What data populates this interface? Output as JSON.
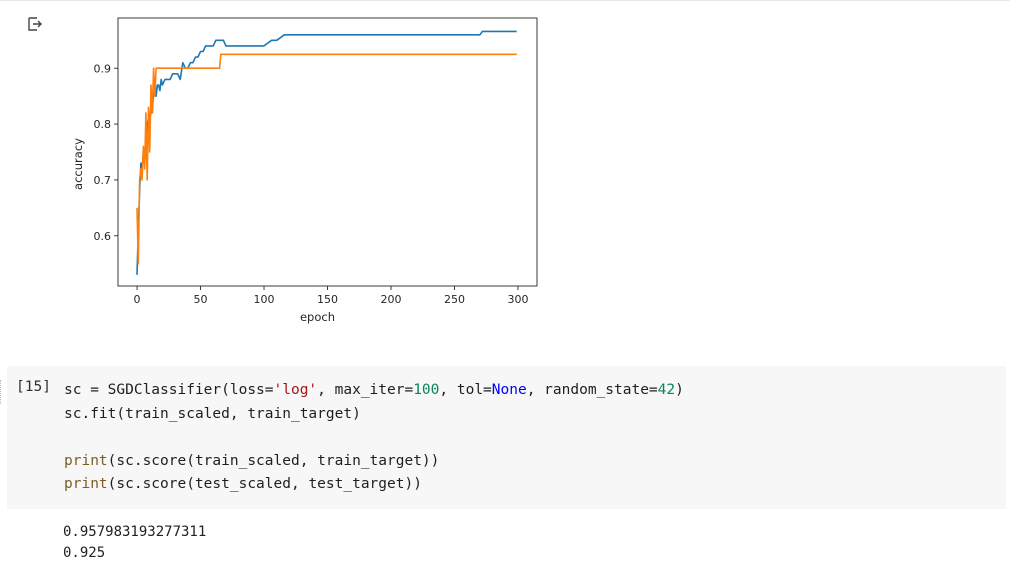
{
  "output_icon": "output-arrow-icon",
  "chart_data": {
    "type": "line",
    "xlabel": "epoch",
    "ylabel": "accuracy",
    "xlim": [
      -15,
      315
    ],
    "ylim": [
      0.51,
      0.99
    ],
    "xticks": [
      0,
      50,
      100,
      150,
      200,
      250,
      300
    ],
    "yticks": [
      0.6,
      0.7,
      0.8,
      0.9
    ],
    "ytick_labels": [
      "0.6",
      "0.7",
      "0.8",
      "0.9"
    ],
    "grid": false,
    "series": [
      {
        "color": "#1f77b4",
        "x": [
          0,
          1,
          2,
          3,
          4,
          5,
          6,
          7,
          8,
          9,
          10,
          11,
          12,
          13,
          14,
          15,
          16,
          17,
          18,
          19,
          20,
          22,
          24,
          26,
          28,
          30,
          32,
          34,
          36,
          38,
          40,
          42,
          44,
          46,
          48,
          50,
          52,
          54,
          56,
          58,
          60,
          62,
          64,
          66,
          68,
          70,
          80,
          90,
          100,
          106,
          110,
          116,
          120,
          140,
          160,
          200,
          240,
          270,
          272,
          299
        ],
        "y": [
          0.53,
          0.61,
          0.68,
          0.73,
          0.72,
          0.75,
          0.73,
          0.77,
          0.8,
          0.81,
          0.8,
          0.83,
          0.82,
          0.86,
          0.88,
          0.85,
          0.87,
          0.87,
          0.86,
          0.88,
          0.87,
          0.88,
          0.88,
          0.88,
          0.89,
          0.89,
          0.89,
          0.88,
          0.91,
          0.9,
          0.9,
          0.91,
          0.91,
          0.92,
          0.92,
          0.93,
          0.93,
          0.94,
          0.94,
          0.94,
          0.94,
          0.95,
          0.95,
          0.95,
          0.95,
          0.94,
          0.94,
          0.94,
          0.94,
          0.95,
          0.95,
          0.96,
          0.96,
          0.96,
          0.96,
          0.96,
          0.96,
          0.96,
          0.966,
          0.966
        ]
      },
      {
        "color": "#ff7f0e",
        "x": [
          0,
          1,
          2,
          3,
          4,
          5,
          6,
          7,
          8,
          9,
          10,
          11,
          12,
          13,
          14,
          15,
          16,
          18,
          20,
          25,
          30,
          40,
          50,
          60,
          65,
          66,
          67,
          80,
          100,
          150,
          200,
          250,
          299
        ],
        "y": [
          0.65,
          0.55,
          0.7,
          0.72,
          0.7,
          0.76,
          0.72,
          0.82,
          0.7,
          0.83,
          0.75,
          0.87,
          0.82,
          0.9,
          0.85,
          0.9,
          0.9,
          0.9,
          0.9,
          0.9,
          0.9,
          0.9,
          0.9,
          0.9,
          0.9,
          0.925,
          0.925,
          0.925,
          0.925,
          0.925,
          0.925,
          0.925,
          0.925
        ]
      }
    ]
  },
  "cell": {
    "exec_count": "[15]",
    "lines": [
      [
        {
          "t": "sc = SGDClassifier(loss="
        },
        {
          "t": "'log'",
          "c": "str"
        },
        {
          "t": ", max_iter="
        },
        {
          "t": "100",
          "c": "num"
        },
        {
          "t": ", tol="
        },
        {
          "t": "None",
          "c": "kw"
        },
        {
          "t": ", random_state="
        },
        {
          "t": "42",
          "c": "num"
        },
        {
          "t": ")"
        }
      ],
      [
        {
          "t": "sc.fit(train_scaled, train_target)"
        }
      ],
      [],
      [
        {
          "t": "print",
          "c": "fn"
        },
        {
          "t": "(sc.score(train_scaled, train_target))"
        }
      ],
      [
        {
          "t": "print",
          "c": "fn"
        },
        {
          "t": "(sc.score(test_scaled, test_target))"
        }
      ]
    ]
  },
  "output": {
    "lines": [
      "0.957983193277311",
      "0.925"
    ]
  }
}
